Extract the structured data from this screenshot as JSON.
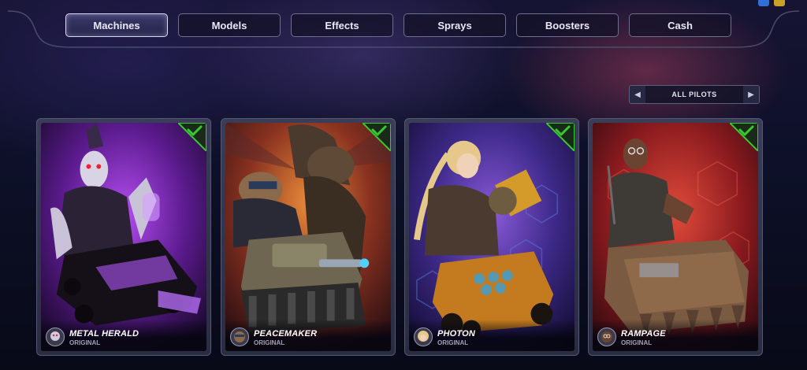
{
  "tabs": [
    {
      "label": "Machines",
      "active": true
    },
    {
      "label": "Models",
      "active": false
    },
    {
      "label": "Effects",
      "active": false
    },
    {
      "label": "Sprays",
      "active": false
    },
    {
      "label": "Boosters",
      "active": false
    },
    {
      "label": "Cash",
      "active": false
    }
  ],
  "filter": {
    "label": "ALL PILOTS"
  },
  "cards": [
    {
      "name": "METAL HERALD",
      "subtitle": "ORIGINAL",
      "owned": true,
      "theme_color": "#8a2fc0"
    },
    {
      "name": "PEACEMAKER",
      "subtitle": "ORIGINAL",
      "owned": true,
      "theme_color": "#b0542a"
    },
    {
      "name": "PHOTON",
      "subtitle": "ORIGINAL",
      "owned": true,
      "theme_color": "#5e3ab8"
    },
    {
      "name": "RAMPAGE",
      "subtitle": "ORIGINAL",
      "owned": true,
      "theme_color": "#a82a2a"
    }
  ],
  "colors": {
    "check_green": "#38c932",
    "accent_border": "#d8dbf0"
  }
}
